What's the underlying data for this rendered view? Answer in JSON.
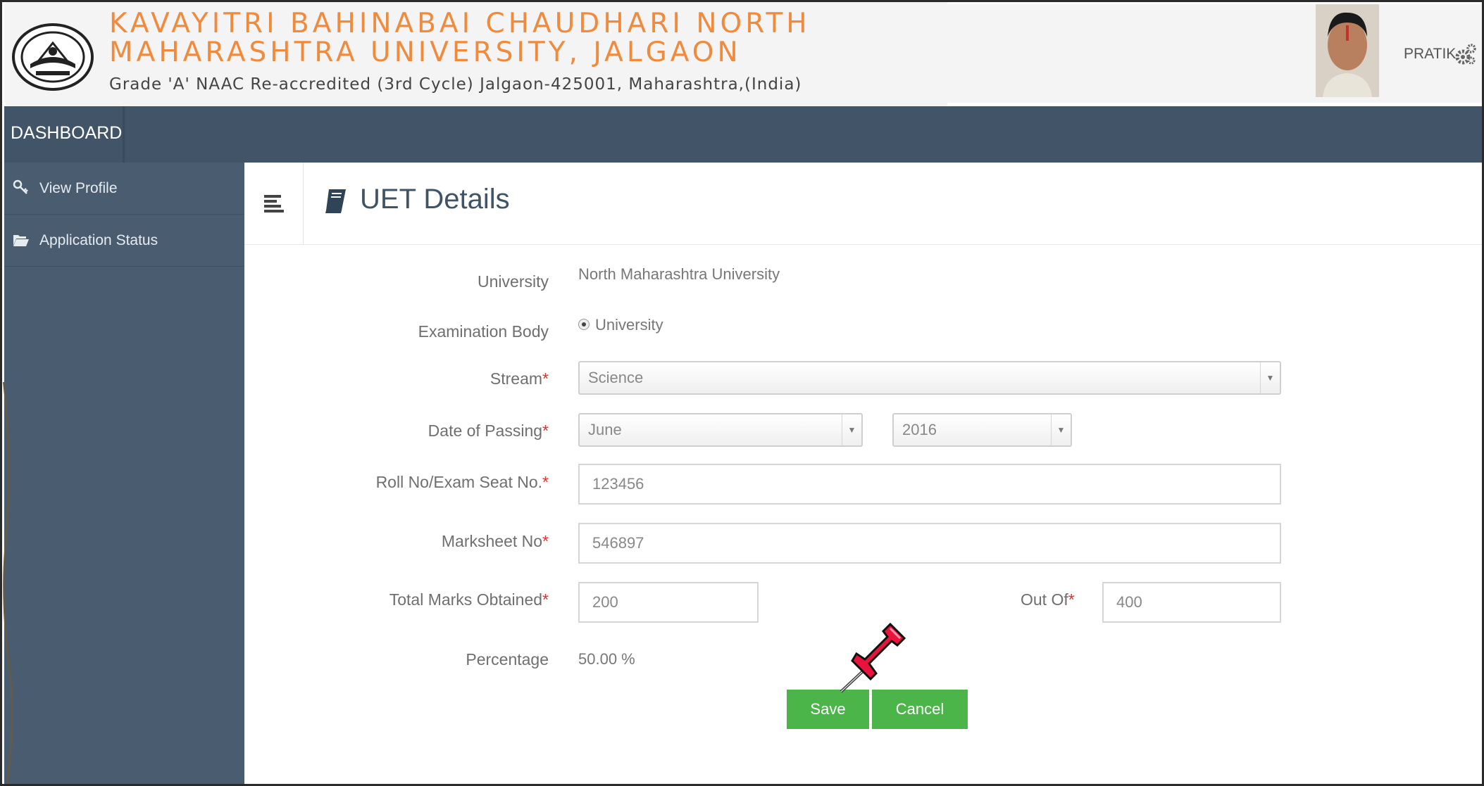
{
  "header": {
    "title_line1": "KAVAYITRI BAHINABAI CHAUDHARI NORTH",
    "title_line2": "MAHARASHTRA UNIVERSITY, JALGAON",
    "subtitle": "Grade 'A' NAAC Re-accredited (3rd Cycle) Jalgaon-425001, Maharashtra,(India)",
    "user_name": "PRATIK"
  },
  "topbar": {
    "title": "DASHBOARD"
  },
  "sidebar": {
    "items": [
      {
        "label": "View Profile",
        "icon": "key-icon"
      },
      {
        "label": "Application Status",
        "icon": "folder-open-icon"
      }
    ]
  },
  "page": {
    "title": "UET Details"
  },
  "form": {
    "university_label": "University",
    "university_value": "North Maharashtra University",
    "exam_body_label": "Examination Body",
    "exam_body_value": "University",
    "stream_label": "Stream",
    "stream_value": "Science",
    "date_label": "Date of Passing",
    "month_value": "June",
    "year_value": "2016",
    "roll_label": "Roll No/Exam Seat No.",
    "roll_value": "123456",
    "marksheet_label": "Marksheet No",
    "marksheet_value": "546897",
    "total_label": "Total Marks Obtained",
    "total_value": "200",
    "outof_label": "Out Of",
    "outof_value": "400",
    "percentage_label": "Percentage",
    "percentage_value": "50.00 %",
    "required_mark": "*"
  },
  "buttons": {
    "save": "Save",
    "cancel": "Cancel"
  },
  "colors": {
    "accent_orange": "#f08a3c",
    "nav_dark": "#425568",
    "sidebar": "#4a5d70",
    "button_green": "#4cb54a",
    "required_red": "#e0302c"
  }
}
